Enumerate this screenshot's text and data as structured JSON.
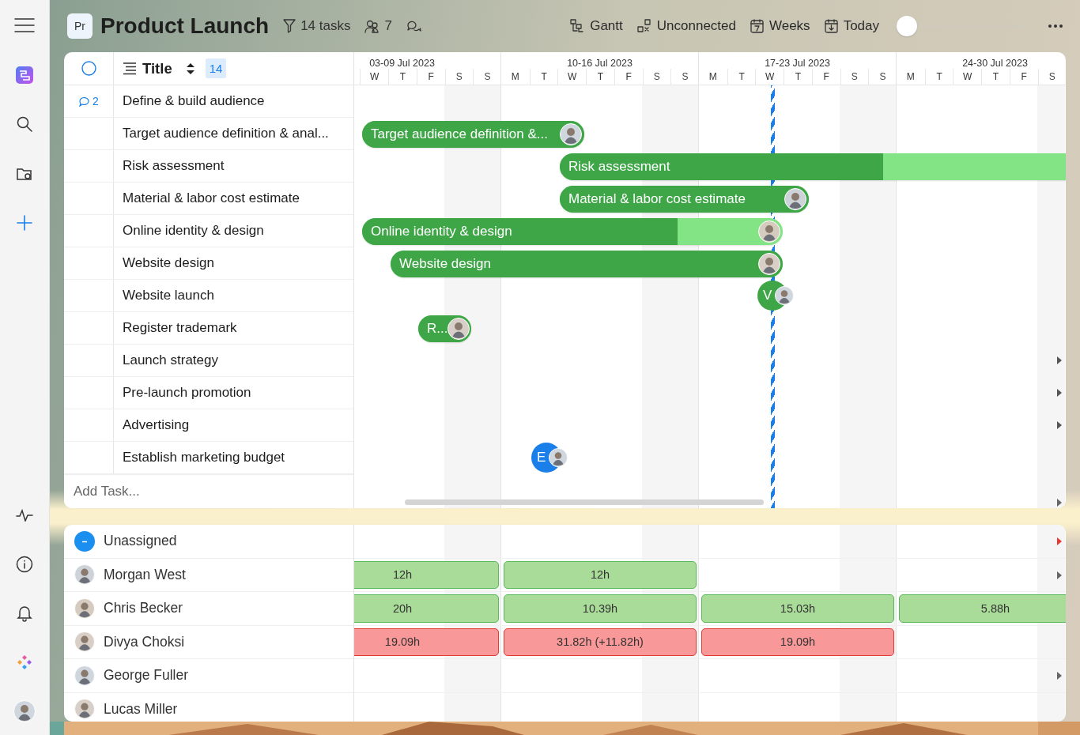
{
  "header": {
    "project_badge": "Pr",
    "title": "Product Launch",
    "task_count": "14 tasks",
    "member_count": "7",
    "views": [
      {
        "kind": "view",
        "label": "Gantt"
      },
      {
        "kind": "links",
        "label": "Unconnected"
      },
      {
        "kind": "scale",
        "label": "Weeks"
      },
      {
        "kind": "today",
        "label": "Today"
      }
    ],
    "zoom": {
      "level": 0
    }
  },
  "task_table": {
    "all_checked": false,
    "title_column": "Title",
    "count": "14",
    "add_placeholder": "Add Task...",
    "tasks": [
      {
        "title": "Define & build audience",
        "comments": "2"
      },
      {
        "title": "Target audience definition & anal...",
        "bar": {
          "kind": "bar",
          "label": "Target audience definition &...",
          "color": "#3fa648",
          "level": 1,
          "assignee": true
        }
      },
      {
        "title": "Risk assessment",
        "bar": {
          "kind": "bar",
          "label": "Risk assessment",
          "color": "#3fa648",
          "level": 0.62,
          "assignee": false
        }
      },
      {
        "title": "Material & labor cost estimate",
        "bar": {
          "kind": "bar",
          "label": "Material & labor cost estimate",
          "color": "#3fa648",
          "level": 1,
          "assignee": true
        }
      },
      {
        "title": "Online identity & design",
        "bar": {
          "kind": "bar",
          "label": "Online identity & design",
          "color": "#3fa648",
          "level": 0.75,
          "assignee": true
        }
      },
      {
        "title": "Website design",
        "bar": {
          "kind": "bar",
          "label": "Website design",
          "color": "#3fa648",
          "level": 1,
          "assignee": true
        }
      },
      {
        "title": "Website launch",
        "bar": {
          "kind": "milestone",
          "label": "V",
          "color": "#3fa648",
          "assignee": true
        }
      },
      {
        "title": "Register trademark",
        "bar": {
          "kind": "bar",
          "label": "R...",
          "color": "#3fa648",
          "level": 1,
          "assignee": true
        }
      },
      {
        "title": "Launch strategy",
        "more_right": true
      },
      {
        "title": "Pre-launch promotion",
        "more_right": true
      },
      {
        "title": "Advertising",
        "more_right": true
      },
      {
        "title": "Establish marketing budget",
        "bar": {
          "kind": "milestone",
          "label": "E",
          "color": "#1a7fe8",
          "assignee": true
        }
      }
    ]
  },
  "timeline": {
    "weeks": [
      {
        "label": "03-09 Jul 2023",
        "days": [
          {
            "d": "W",
            "weekend": false
          },
          {
            "d": "T",
            "weekend": false
          },
          {
            "d": "F",
            "weekend": false
          },
          {
            "d": "S",
            "weekend": true
          },
          {
            "d": "S",
            "weekend": true
          }
        ]
      },
      {
        "label": "10-16 Jul 2023",
        "days": [
          {
            "d": "M",
            "weekend": false
          },
          {
            "d": "T",
            "weekend": false
          },
          {
            "d": "W",
            "weekend": false
          },
          {
            "d": "T",
            "weekend": false
          },
          {
            "d": "F",
            "weekend": false
          },
          {
            "d": "S",
            "weekend": true
          },
          {
            "d": "S",
            "weekend": true
          }
        ]
      },
      {
        "label": "17-23 Jul 2023",
        "days": [
          {
            "d": "M",
            "weekend": false
          },
          {
            "d": "T",
            "weekend": false
          },
          {
            "d": "W",
            "weekend": false
          },
          {
            "d": "T",
            "weekend": false
          },
          {
            "d": "F",
            "weekend": false
          },
          {
            "d": "S",
            "weekend": true
          },
          {
            "d": "S",
            "weekend": true
          }
        ]
      },
      {
        "label": "24-30 Jul 2023",
        "days": [
          {
            "d": "M",
            "weekend": false
          },
          {
            "d": "T",
            "weekend": false
          },
          {
            "d": "W",
            "weekend": false
          },
          {
            "d": "T",
            "weekend": false
          },
          {
            "d": "F",
            "weekend": false
          },
          {
            "d": "S",
            "weekend": true
          }
        ]
      }
    ]
  },
  "workload": {
    "people": [
      {
        "name": "Unassigned",
        "kind": "unassigned",
        "more_right": true,
        "alert": true
      },
      {
        "name": "Morgan West",
        "kind": "person",
        "more_right": true,
        "alert": false,
        "hours": [
          {
            "text": "12h",
            "over": false
          },
          {
            "text": "12h",
            "over": false
          }
        ]
      },
      {
        "name": "Chris Becker",
        "kind": "person",
        "hours": [
          {
            "text": "20h",
            "over": false
          },
          {
            "text": "10.39h",
            "over": false
          },
          {
            "text": "15.03h",
            "over": false
          },
          {
            "text": "5.88h",
            "over": false
          }
        ]
      },
      {
        "name": "Divya Choksi",
        "kind": "person",
        "hours": [
          {
            "text": "19.09h",
            "over": true
          },
          {
            "text": "31.82h (+11.82h)",
            "over": true
          },
          {
            "text": "19.09h",
            "over": true
          }
        ]
      },
      {
        "name": "George Fuller",
        "kind": "person",
        "more_right": true,
        "alert": false
      },
      {
        "name": "Lucas Miller",
        "kind": "person"
      }
    ]
  }
}
